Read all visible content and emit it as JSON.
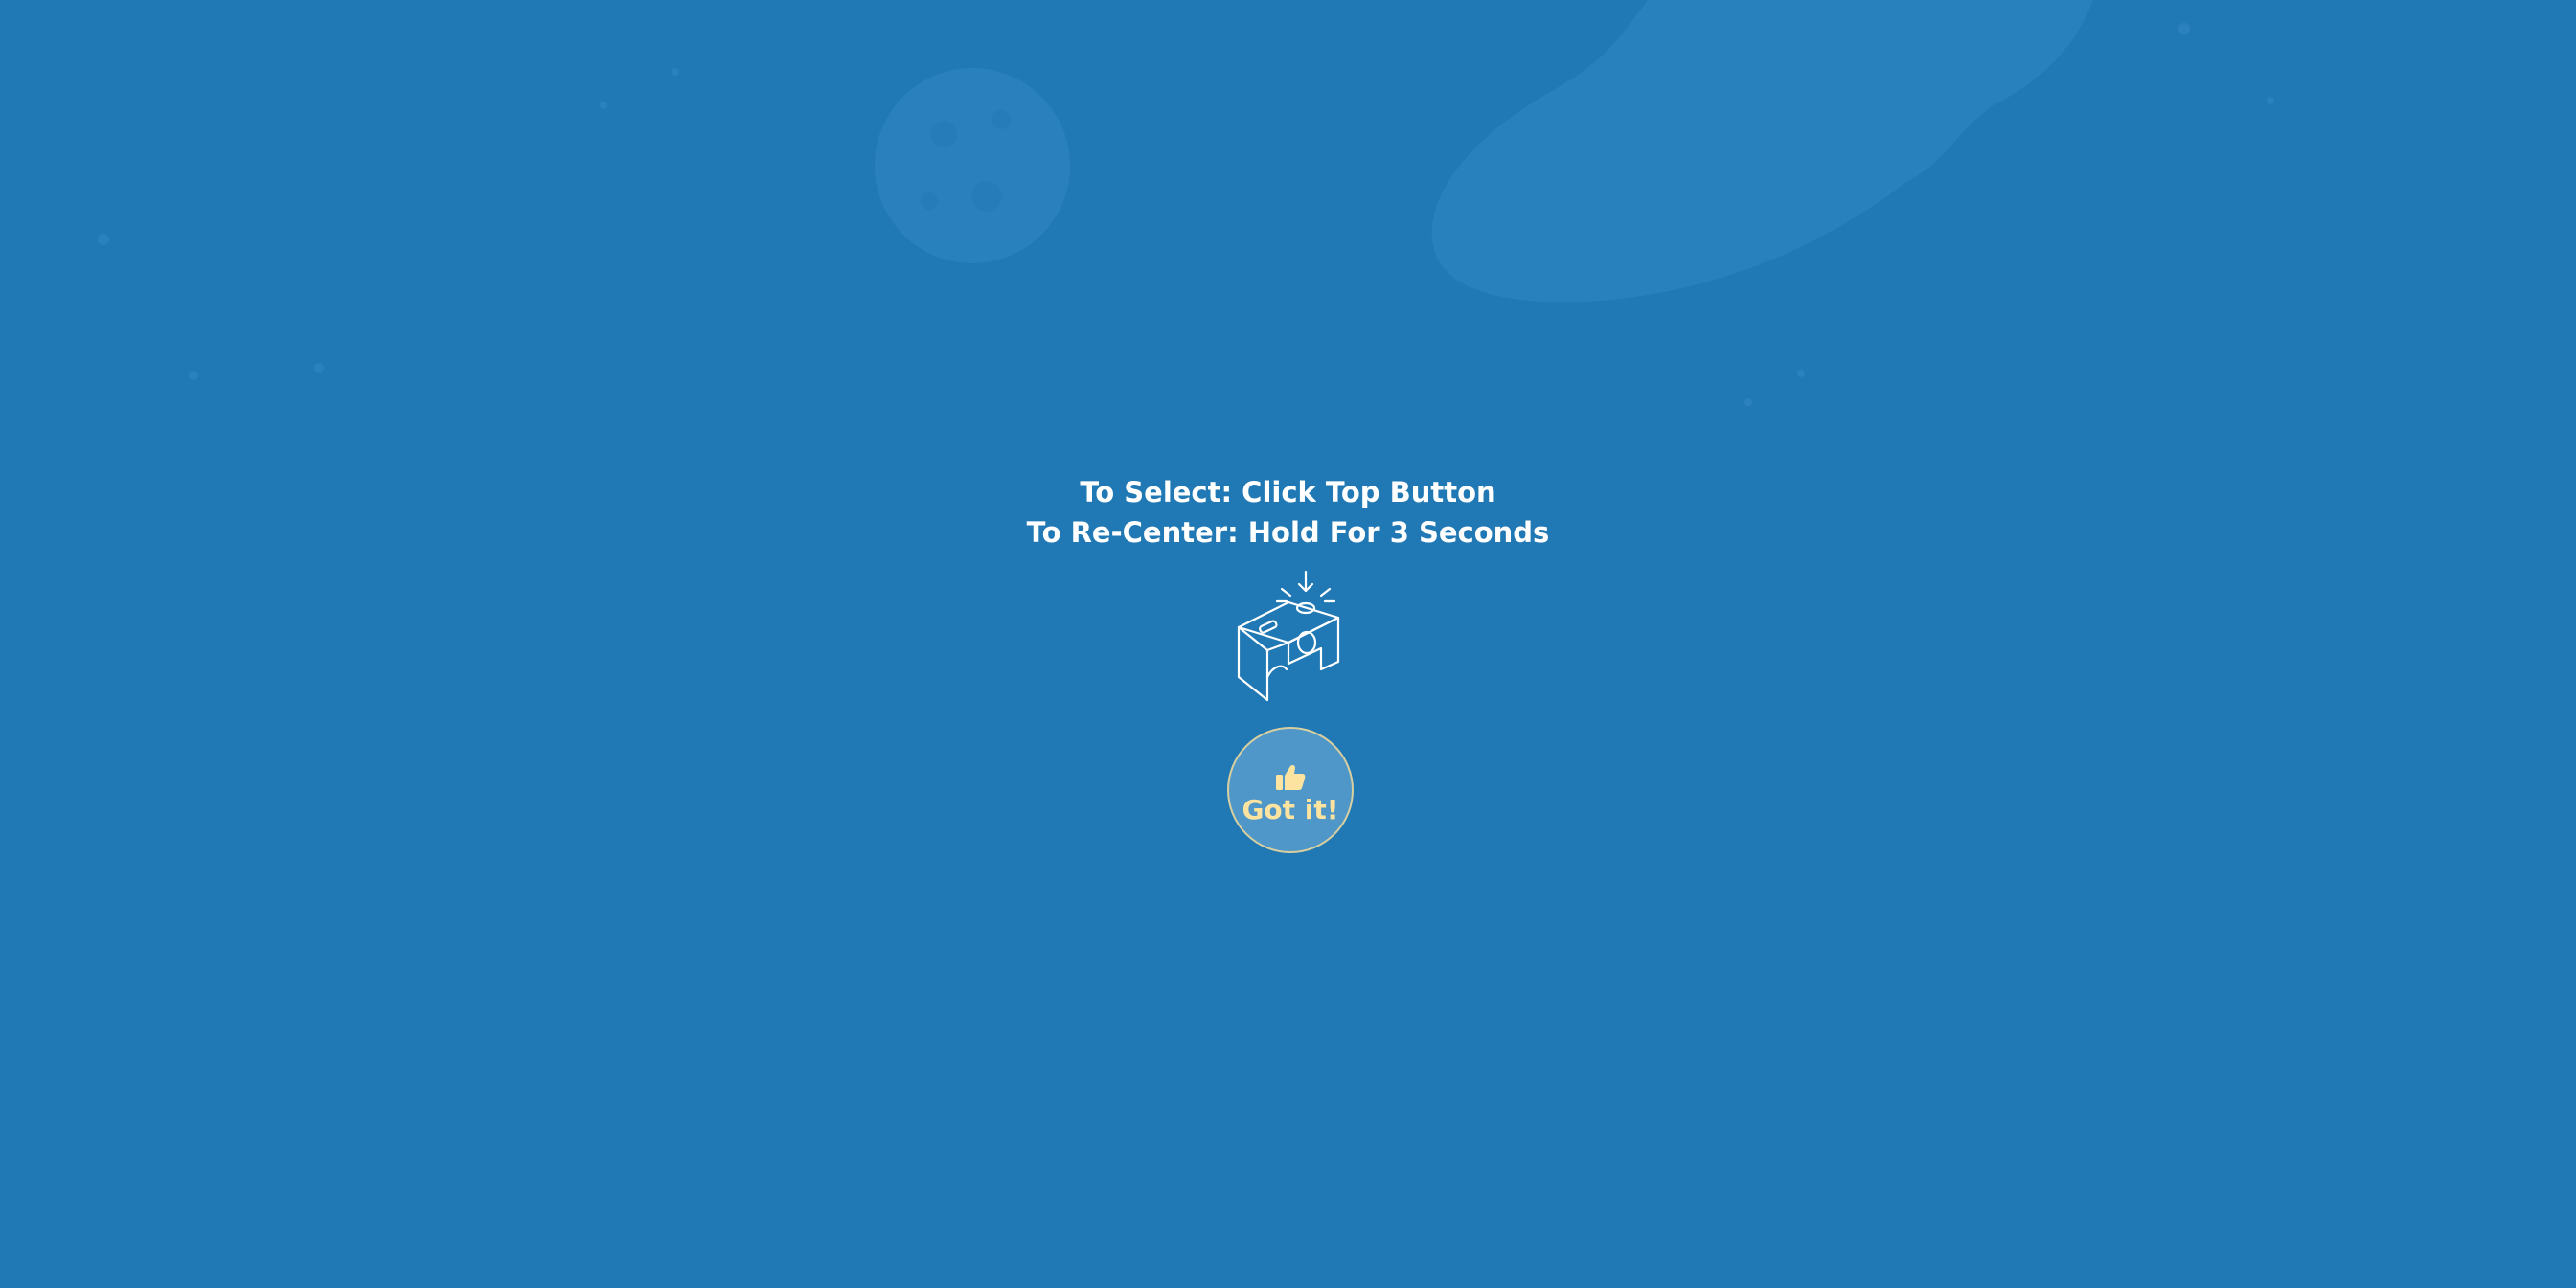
{
  "theme": {
    "background": "#2079b4",
    "text": "#ffffff",
    "button_fill": "#4f97c8",
    "button_text": "#fde3a0",
    "button_border": "#d8cfa0"
  },
  "instructions": {
    "select_line": "To Select: Click Top Button",
    "recenter_line": "To Re-Center: Hold For 3 Seconds"
  },
  "illustration": {
    "icon": "cardboard-viewer-icon"
  },
  "confirm_button": {
    "icon": "thumbs-up-icon",
    "label": "Got it!"
  }
}
